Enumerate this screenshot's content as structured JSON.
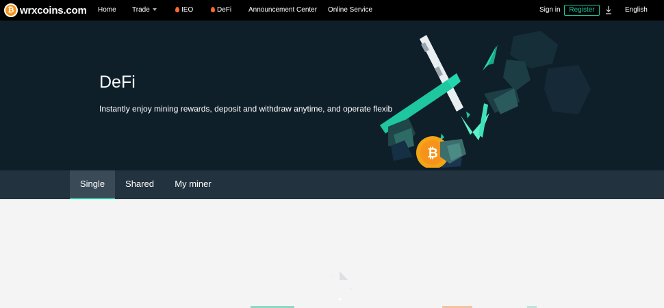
{
  "brand": {
    "name": "wrxcoins.com",
    "mark": "₿"
  },
  "nav": {
    "home": "Home",
    "trade": "Trade",
    "ieo": "IEO",
    "defi": "DeFi",
    "announcement": "Announcement Center",
    "online_service": "Online Service",
    "sign_in": "Sign in",
    "register": "Register",
    "language": "English"
  },
  "hero": {
    "title": "DeFi",
    "subtitle": "Instantly enjoy mining rewards, deposit and withdraw anytime, and operate flexib"
  },
  "tabs": [
    "Single",
    "Shared",
    "My miner"
  ],
  "colors": {
    "accent": "#1ec7a0",
    "hero_bg": "#0f1f2a",
    "tabbar_bg": "#22323e",
    "coin": "#f7931a"
  },
  "icons": {
    "download": "download-icon",
    "trade_dropdown": "chevron-down-icon",
    "hot": "flame-icon"
  }
}
